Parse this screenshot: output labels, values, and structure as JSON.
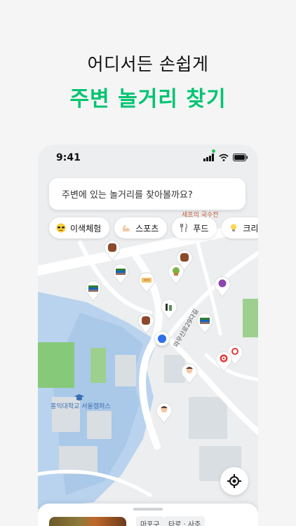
{
  "headline": {
    "line1": "어디서든 손쉽게",
    "line2": "주변 놀거리 찾기"
  },
  "status": {
    "time": "9:41"
  },
  "search": {
    "placeholder": "주변에 있는 놀거리를 찾아볼까요?"
  },
  "chips": [
    {
      "label": "이색체험",
      "icon": "sunglasses-emoji-icon"
    },
    {
      "label": "스포츠",
      "icon": "flexed-arm-emoji-icon"
    },
    {
      "label": "푸드",
      "icon": "fork-knife-icon"
    },
    {
      "label": "크리",
      "icon": "lightbulb-emoji-icon"
    }
  ],
  "map": {
    "labels": {
      "restaurant": "세프의 국수전",
      "campus": "홍익대학교 서울캠퍼스",
      "street": "와우산로29다길"
    }
  },
  "sheet": {
    "tags": [
      "마포구",
      "타로 · 사주"
    ]
  },
  "colors": {
    "accent": "#00c471",
    "location_blue": "#2f6fe8"
  }
}
